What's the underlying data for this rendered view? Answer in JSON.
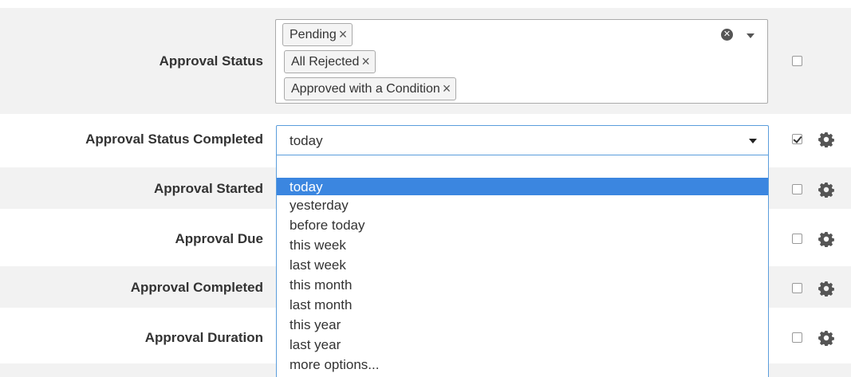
{
  "fields": {
    "approval_status": {
      "label": "Approval Status",
      "chips": [
        "Pending",
        "All Rejected",
        "Approved with a Condition"
      ],
      "chip_remove_glyph": "×",
      "clear_glyph": "✕",
      "checked": false
    },
    "approval_status_completed": {
      "label": "Approval Status Completed",
      "value": "today",
      "checked": true,
      "options": [
        "today",
        "yesterday",
        "before today",
        "this week",
        "last week",
        "this month",
        "last month",
        "this year",
        "last year",
        "more options..."
      ],
      "highlighted_option": "today"
    },
    "approval_started": {
      "label": "Approval Started",
      "checked": false
    },
    "approval_due": {
      "label": "Approval Due",
      "checked": false
    },
    "approval_completed": {
      "label": "Approval Completed",
      "checked": false
    },
    "approval_duration": {
      "label": "Approval Duration",
      "checked": false
    }
  },
  "icons": {
    "settings": "gear-icon",
    "remove": "close-icon",
    "clear": "clear-icon",
    "dropdown": "caret-down-icon"
  },
  "colors": {
    "highlight": "#3b86e0",
    "focus_border": "#5b9ddc",
    "band": "#f2f2f2"
  }
}
